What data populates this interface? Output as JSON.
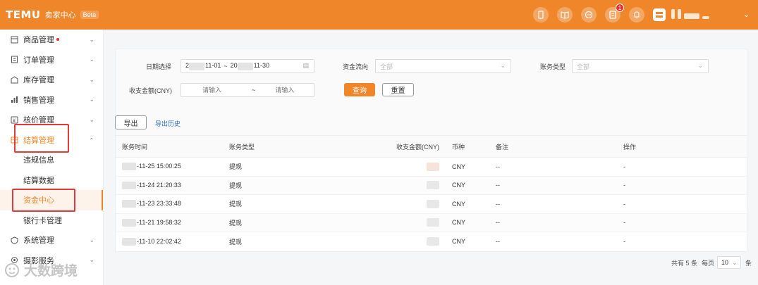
{
  "header": {
    "logo": "TEMU",
    "subtitle": "卖家中心",
    "beta": "Beta",
    "notification_count": "1",
    "icons": [
      "phone-icon",
      "book-icon",
      "chat-icon",
      "document-icon",
      "bell-icon",
      "store-icon"
    ]
  },
  "sidebar": {
    "items": [
      {
        "label": "商品管理",
        "icon": "product-icon"
      },
      {
        "label": "订单管理",
        "icon": "order-icon"
      },
      {
        "label": "库存管理",
        "icon": "warehouse-icon"
      },
      {
        "label": "销售管理",
        "icon": "chart-icon"
      },
      {
        "label": "核价管理",
        "icon": "price-icon"
      },
      {
        "label": "结算管理",
        "icon": "settlement-icon"
      }
    ],
    "sub_items": [
      "违规信息",
      "结算数据",
      "资金中心",
      "银行卡管理"
    ],
    "bottom_items": [
      {
        "label": "系统管理",
        "icon": "system-icon"
      },
      {
        "label": "摄影服务",
        "icon": "camera-icon"
      }
    ]
  },
  "filter": {
    "date_label": "日期选择",
    "date_start": "2",
    "date_start_suffix": "11-01",
    "date_sep": "~",
    "date_end": "20",
    "date_end_suffix": "11-30",
    "flow_label": "资金流向",
    "flow_value": "全部",
    "type_label": "账务类型",
    "type_value": "全部",
    "amount_label": "收支金额(CNY)",
    "amount_min_placeholder": "请输入",
    "amount_sep": "~",
    "amount_max_placeholder": "请输入",
    "search_button": "查询",
    "reset_button": "重置"
  },
  "actions": {
    "export": "导出",
    "export_history": "导出历史"
  },
  "table": {
    "headers": [
      "账务时间",
      "账务类型",
      "收支金额(CNY)",
      "币种",
      "备注",
      "操作"
    ],
    "rows": [
      {
        "time": "-11-25 15:00:25",
        "type": "提现",
        "currency": "CNY",
        "note": "--",
        "op": "-"
      },
      {
        "time": "-11-24 21:20:33",
        "type": "提现",
        "currency": "CNY",
        "note": "--",
        "op": "-"
      },
      {
        "time": "-11-23 23:33:48",
        "type": "提现",
        "currency": "CNY",
        "note": "--",
        "op": "-"
      },
      {
        "time": "-11-21 19:58:32",
        "type": "提现",
        "currency": "CNY",
        "note": "--",
        "op": "-"
      },
      {
        "time": "-11-10 22:02:42",
        "type": "提现",
        "currency": "CNY",
        "note": "--",
        "op": "-"
      }
    ]
  },
  "pagination": {
    "total": "共有 5 条",
    "per_page_label": "每页",
    "page_size": "10",
    "unit": "条"
  },
  "watermark": "大数跨境",
  "colors": {
    "brand": "#f0862a",
    "highlight": "#e23a3a",
    "link": "#2f6fd6"
  }
}
